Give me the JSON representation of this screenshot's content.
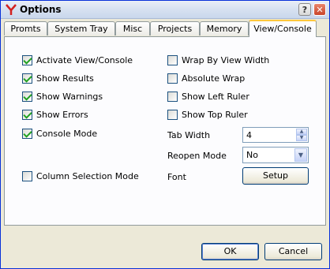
{
  "window": {
    "title": "Options"
  },
  "titlebar": {
    "help_glyph": "?",
    "close_glyph": "✕"
  },
  "tabs": [
    {
      "label": "Promts"
    },
    {
      "label": "System Tray"
    },
    {
      "label": "Misc"
    },
    {
      "label": "Projects"
    },
    {
      "label": "Memory"
    },
    {
      "label": "View/Console",
      "active": true
    }
  ],
  "left_options": [
    {
      "label": "Activate View/Console",
      "checked": true
    },
    {
      "label": "Show Results",
      "checked": true
    },
    {
      "label": "Show Warnings",
      "checked": true
    },
    {
      "label": "Show Errors",
      "checked": true
    },
    {
      "label": "Console Mode",
      "checked": true
    },
    {
      "label": "Column Selection Mode",
      "checked": false
    }
  ],
  "right_options": [
    {
      "label": "Wrap By View Width",
      "checked": false
    },
    {
      "label": "Absolute Wrap",
      "checked": false
    },
    {
      "label": "Show Left Ruler",
      "checked": false
    },
    {
      "label": "Show Top Ruler",
      "checked": false
    }
  ],
  "tab_width": {
    "label": "Tab Width",
    "value": "4"
  },
  "reopen_mode": {
    "label": "Reopen Mode",
    "value": "No"
  },
  "font": {
    "label": "Font",
    "button": "Setup"
  },
  "footer": {
    "ok": "OK",
    "cancel": "Cancel"
  },
  "icons": {
    "app": "red-y-logo-icon",
    "help": "question-mark-icon",
    "close": "close-icon"
  },
  "colors": {
    "title_border": "#0831d9",
    "check": "#21a121",
    "active_tab_accent": "#ffc83c"
  }
}
